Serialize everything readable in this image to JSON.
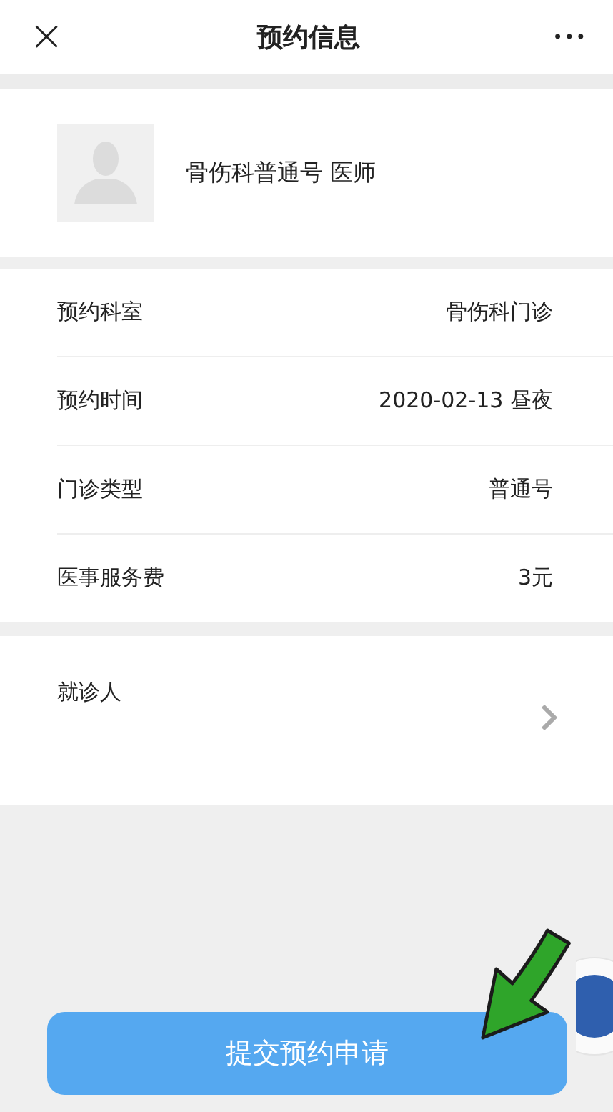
{
  "header": {
    "close": "×",
    "title": "预约信息",
    "more": "•••"
  },
  "doctor": {
    "name": "骨伤科普通号 医师"
  },
  "details": [
    {
      "label": "预约科室",
      "value": "骨伤科门诊"
    },
    {
      "label": "预约时间",
      "value": "2020-02-13 昼夜"
    },
    {
      "label": "门诊类型",
      "value": "普通号"
    },
    {
      "label": "医事服务费",
      "value": "3元"
    }
  ],
  "patient": {
    "label": "就诊人"
  },
  "submit": {
    "label": "提交预约申请"
  }
}
